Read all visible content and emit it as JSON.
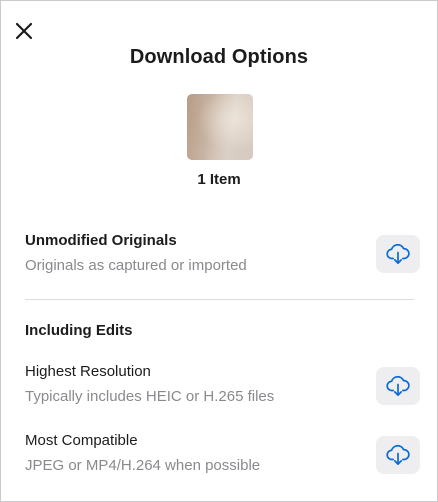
{
  "header": {
    "close_icon": "close-icon",
    "title": "Download Options"
  },
  "preview": {
    "count_label": "1 Item"
  },
  "options": {
    "unmodified": {
      "title": "Unmodified Originals",
      "subtitle": "Originals as captured or imported",
      "button_icon": "cloud-download-icon"
    },
    "edits_header": "Including Edits",
    "highest": {
      "title": "Highest Resolution",
      "subtitle": "Typically includes HEIC or H.265 files",
      "button_icon": "cloud-download-icon"
    },
    "compatible": {
      "title": "Most Compatible",
      "subtitle": "JPEG or MP4/H.264 when possible",
      "button_icon": "cloud-download-icon"
    }
  },
  "colors": {
    "accent": "#0a6bd6",
    "button_bg": "#eeeef0",
    "secondary_text": "#8a8a8e",
    "divider": "#dcdce0"
  }
}
